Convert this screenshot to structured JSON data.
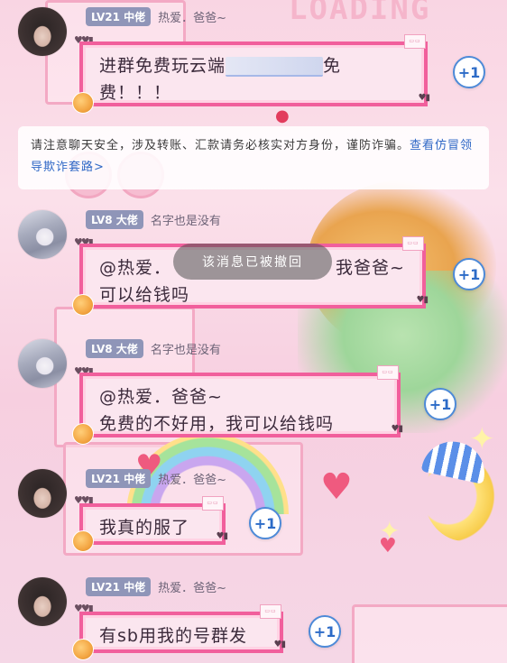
{
  "system_notice": {
    "text": "请注意聊天安全，涉及转账、汇款请务必核实对方身份，谨防诈骗。",
    "link": "查看仿冒领导欺诈套路>"
  },
  "toast": "该消息已被撤回",
  "background": {
    "loading_text": "LOADING"
  },
  "messages": [
    {
      "level": "LV21 中佬",
      "nickname": "热爱．爸爸~",
      "lines": [
        "进群免费玩云端",
        "免",
        "费！！！"
      ],
      "plus_one": "+1"
    },
    {
      "level": "LV8 大佬",
      "nickname": "名字也是没有",
      "lines": [
        "@热爱．",
        "我爸爸~",
        "可以给钱吗"
      ],
      "plus_one": "+1"
    },
    {
      "level": "LV8 大佬",
      "nickname": "名字也是没有",
      "lines": [
        "@热爱．爸爸~",
        "免费的不好用，我可以给钱吗"
      ],
      "plus_one": "+1"
    },
    {
      "level": "LV21 中佬",
      "nickname": "热爱．爸爸~",
      "lines": [
        "我真的服了"
      ],
      "plus_one": "+1"
    },
    {
      "level": "LV21 中佬",
      "nickname": "热爱．爸爸~",
      "lines": [
        "有sb用我的号群发"
      ],
      "plus_one": "+1"
    }
  ],
  "colors": {
    "bubble_border": "#f15f9c",
    "bubble_fill": "#fbe6ef",
    "level_badge": "#8f95b8",
    "plus_one_blue": "#2c6bc7",
    "link_blue": "#2f68c6"
  },
  "icons": [
    "heart-chain-icon",
    "squirrel-sticker-icon",
    "plus-one-icon"
  ]
}
